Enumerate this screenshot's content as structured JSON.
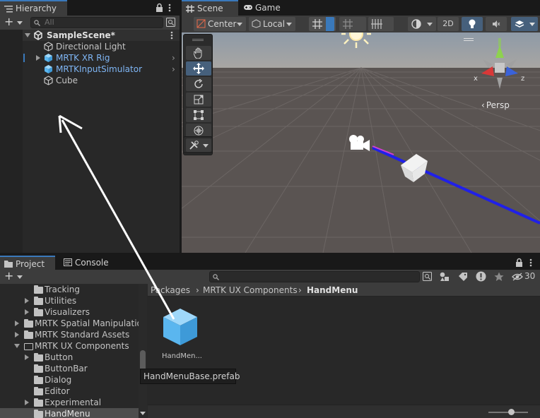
{
  "hierarchy": {
    "tab_label": "Hierarchy",
    "search_placeholder": "All",
    "scene_name": "SampleScene*",
    "items": [
      {
        "label": "Directional Light",
        "prefab": false
      },
      {
        "label": "MRTK XR Rig",
        "prefab": true
      },
      {
        "label": "MRTKInputSimulator",
        "prefab": true
      },
      {
        "label": "Cube",
        "prefab": false
      }
    ]
  },
  "scene": {
    "tab_scene": "Scene",
    "tab_game": "Game",
    "pivot_label": "Center",
    "space_label": "Local",
    "mode_2d": "2D",
    "persp_label": "Persp",
    "gizmo_x": "x",
    "gizmo_z": "z",
    "tools": [
      "hand-tool",
      "move-tool",
      "rotate-tool",
      "scale-tool",
      "rect-tool",
      "transform-tool"
    ]
  },
  "project": {
    "tab_project": "Project",
    "tab_console": "Console",
    "hidden_count": "30",
    "breadcrumb": [
      "Packages",
      "MRTK UX Components",
      "HandMenu"
    ],
    "tree": [
      {
        "label": "Tracking",
        "indent": 2,
        "arrow": "none"
      },
      {
        "label": "Utilities",
        "indent": 2,
        "arrow": "right"
      },
      {
        "label": "Visualizers",
        "indent": 2,
        "arrow": "right"
      },
      {
        "label": "MRTK Spatial Manipulatio",
        "indent": 1,
        "arrow": "right"
      },
      {
        "label": "MRTK Standard Assets",
        "indent": 1,
        "arrow": "right"
      },
      {
        "label": "MRTK UX Components",
        "indent": 1,
        "arrow": "down"
      },
      {
        "label": "Button",
        "indent": 2,
        "arrow": "right"
      },
      {
        "label": "ButtonBar",
        "indent": 2,
        "arrow": "none"
      },
      {
        "label": "Dialog",
        "indent": 2,
        "arrow": "none"
      },
      {
        "label": "Editor",
        "indent": 2,
        "arrow": "none"
      },
      {
        "label": "Experimental",
        "indent": 2,
        "arrow": "right"
      },
      {
        "label": "HandMenu",
        "indent": 2,
        "arrow": "none",
        "selected": true
      }
    ],
    "asset_label": "HandMen...",
    "tooltip": "HandMenuBase.prefab"
  },
  "colors": {
    "accent": "#3a79bb",
    "prefab_text": "#7fb6f5",
    "prefab_icon": "#6ec3f5",
    "scene_bg": "#5a5452"
  }
}
